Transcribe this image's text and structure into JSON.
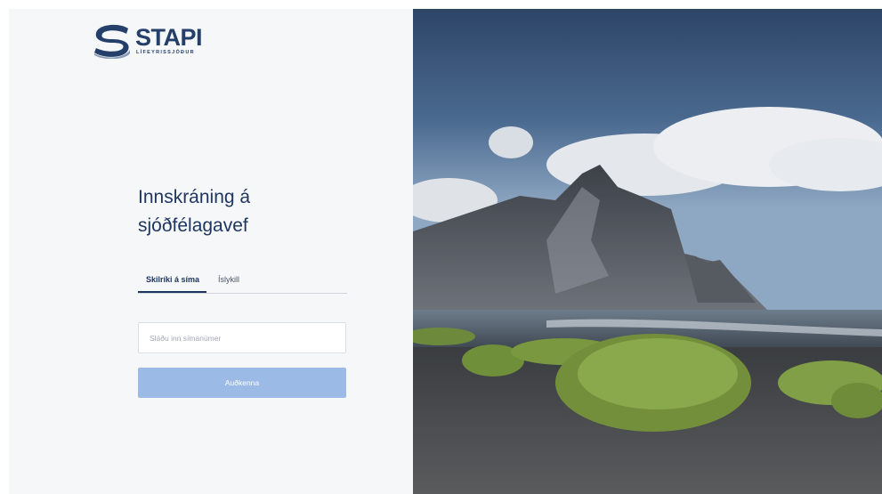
{
  "brand": {
    "name": "STAPI",
    "subtitle": "LÍFEYRISSJÓÐUR",
    "logo_icon": "stapi-s-logo-icon",
    "primary_color": "#253f6b"
  },
  "login": {
    "title_line1": "Innskráning á",
    "title_line2": "sjóðfélagavef",
    "tabs": [
      {
        "label": "Skilríki á síma",
        "active": true
      },
      {
        "label": "Íslykill",
        "active": false
      }
    ],
    "phone_placeholder": "Sláðu inn símanúmer",
    "phone_value": "",
    "submit_label": "Auðkenna",
    "button_color": "#9bbbe6"
  },
  "hero": {
    "image": "mountain-beach-landscape"
  }
}
